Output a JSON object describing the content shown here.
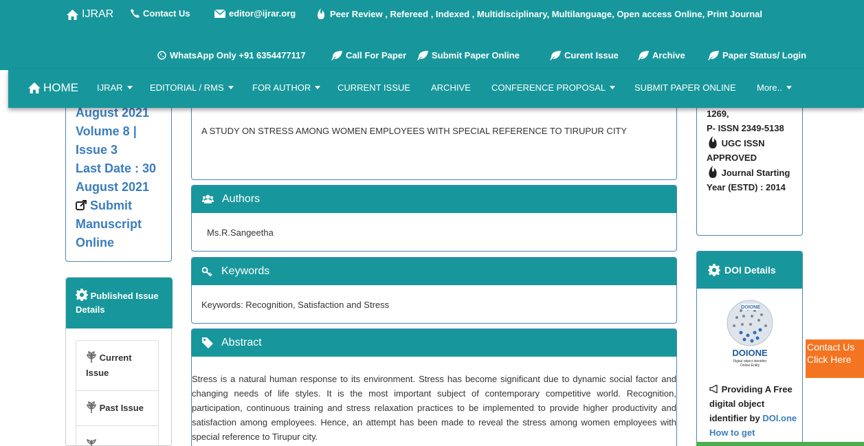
{
  "topbar": {
    "brand": "IJRAR",
    "contact": "Contact Us",
    "email": "editor@ijrar.org",
    "tagline": "Peer Review , Refereed , Indexed , Multidisciplinary, Multilanguage, Open access Online, Print Journal",
    "whatsapp": "WhatsApp Only +91 6354477117",
    "links": [
      "Call For Paper",
      "Submit Paper Online",
      "Curent Issue",
      "Archive",
      "Paper Status/ Login"
    ]
  },
  "nav": {
    "home": "HOME",
    "items": [
      "IJRAR",
      "EDITORIAL / RMS",
      "FOR AUTHOR",
      "CURRENT ISSUE",
      "ARCHIVE",
      "CONFERENCE PROPOSAL",
      "SUBMIT PAPER ONLINE",
      "More.."
    ]
  },
  "left": {
    "cut_top": "August 2021",
    "lines": [
      "Volume 8 |",
      "Issue 3",
      "Last Date : 30",
      "August 2021"
    ],
    "submit": "Submit Manuscript Online",
    "published_title": "Published Issue Details",
    "published_items": [
      "Current Issue",
      "Past Issue"
    ]
  },
  "paper": {
    "title": "A STUDY ON STRESS AMONG WOMEN EMPLOYEES WITH SPECIAL REFERENCE TO TIRUPUR CITY",
    "authors_label": "Authors",
    "authors": "Ms.R.Sangeetha",
    "keywords_label": "Keywords",
    "keywords": "Keywords: Recognition, Satisfaction and Stress",
    "abstract_label": "Abstract",
    "abstract": "Stress is a natural human response to its environment. Stress has become significant due to dynamic social factor and changing needs of life styles. It is the most important subject of contemporary competitive world. Recognition, participation, continuous training and stress relaxation practices to be implemented to provide higher productivity and satisfaction among employees. Hence, an attempt has been made to reveal the stress among women employees with special reference to Tirupur city."
  },
  "right": {
    "issn_cut": "1269,",
    "pissn": "P- ISSN 2349-5138",
    "ugc": "UGC ISSN APPROVED",
    "journal": "Journal Starting Year (ESTD) : 2014",
    "doi_title": "DOI Details",
    "doi_logo_text": "DOIONE",
    "doi_logo_sub": "Digital object identifier Online Entity",
    "doi_promo": "Providing A Free digital object identifier by",
    "doi_link": "DOI.one How to get"
  },
  "float": {
    "contact": "Contact Us Click Here"
  },
  "colors": {
    "teal": "#17979b",
    "link_blue": "#3b7dbd",
    "orange": "#f47521",
    "green": "#4cae4c"
  }
}
